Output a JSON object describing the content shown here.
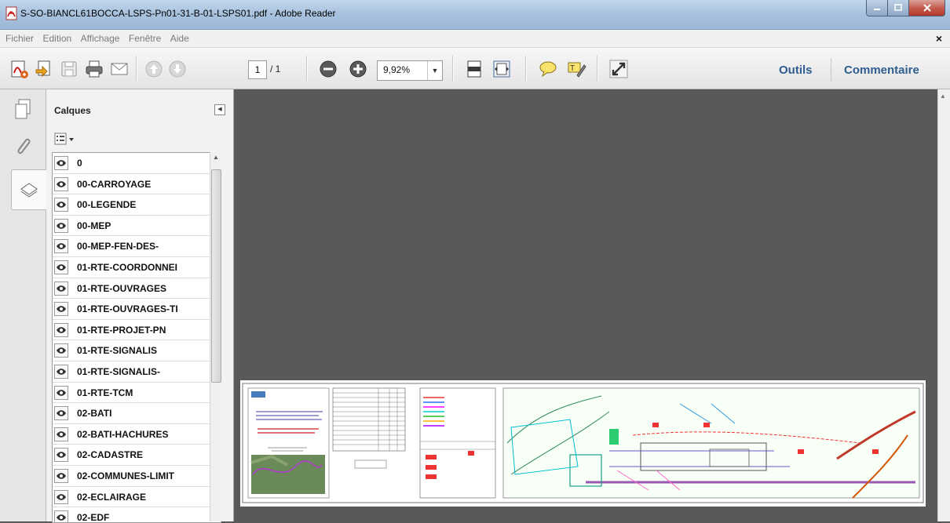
{
  "window": {
    "title": "S-SO-BIANCL61BOCCA-LSPS-Pn01-31-B-01-LSPS01.pdf - Adobe Reader"
  },
  "menu": {
    "items": [
      "Fichier",
      "Edition",
      "Affichage",
      "Fenêtre",
      "Aide"
    ],
    "close": "×"
  },
  "toolbar": {
    "page_current": "1",
    "page_total": "/ 1",
    "zoom": "9,92%",
    "tools_label": "Outils",
    "comment_label": "Commentaire"
  },
  "layers_panel": {
    "title": "Calques",
    "layers": [
      "0",
      "00-CARROYAGE",
      "00-LEGENDE",
      "00-MEP",
      "00-MEP-FEN-DES-",
      "01-RTE-COORDONNEI",
      "01-RTE-OUVRAGES",
      "01-RTE-OUVRAGES-TI",
      "01-RTE-PROJET-PN",
      "01-RTE-SIGNALIS",
      "01-RTE-SIGNALIS-",
      "01-RTE-TCM",
      "02-BATI",
      "02-BATI-HACHURES",
      "02-CADASTRE",
      "02-COMMUNES-LIMIT",
      "02-ECLAIRAGE",
      "02-EDF"
    ]
  },
  "colors": {
    "link": "#2e5d8f",
    "document_bg": "#58595b"
  }
}
